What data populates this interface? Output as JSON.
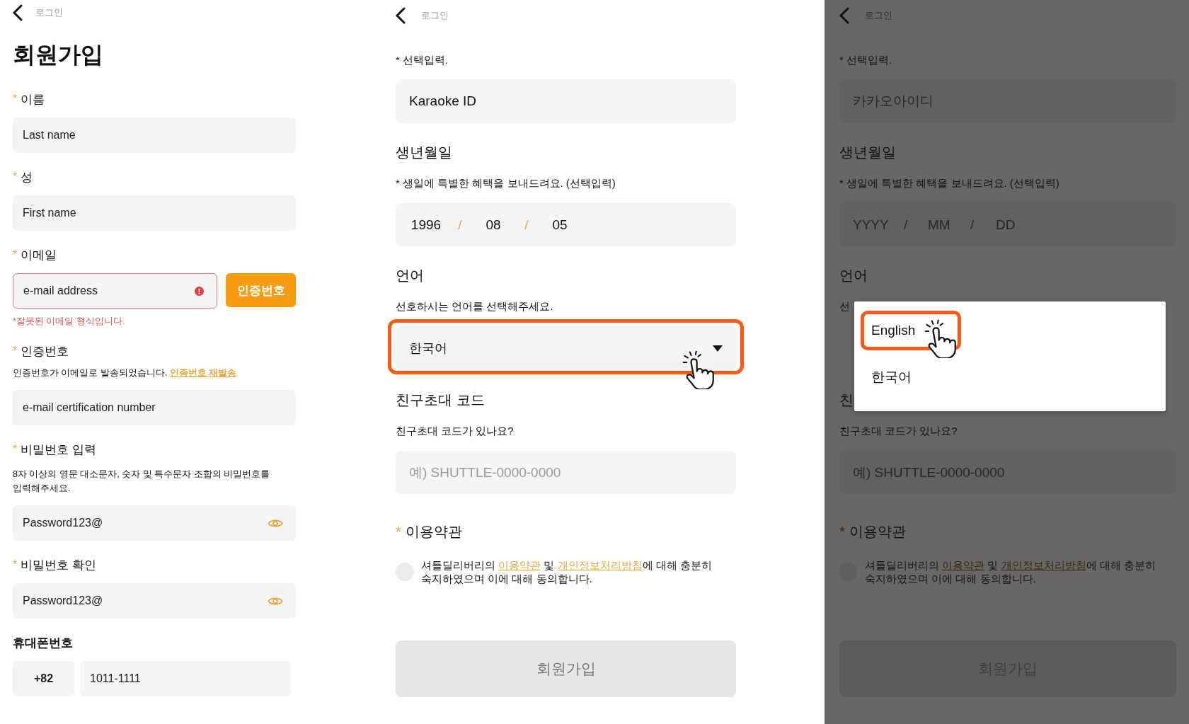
{
  "signup": {
    "back_label": "로그인",
    "title": "회원가입",
    "sections": [
      {
        "kind": "text",
        "mark": "*",
        "label": "이름",
        "value": "Last name"
      },
      {
        "kind": "text",
        "mark": "*",
        "label": "성",
        "value": "First name"
      },
      {
        "kind": "email",
        "mark": "*",
        "label": "이메일",
        "value": "e-mail address",
        "invalid": true,
        "button": "인증번호",
        "error": "*잘못된 이메일 형식입니다."
      },
      {
        "kind": "code",
        "mark": "*",
        "label": "인증번호",
        "helper": "인증번호가 이메일로 발송되었습니다.",
        "link": "인증번호 재발송",
        "value": "e-mail certification number"
      },
      {
        "kind": "password",
        "mark": "*",
        "label": "비밀번호 입력",
        "helper": "8자 이상의 영문 대소문자, 숫자 및 특수문자 조합의 비밀번호를\n입력해주세요.",
        "value": "Password123@"
      },
      {
        "kind": "password",
        "mark": "*",
        "label": "비밀번호 확인",
        "value": "Password123@"
      },
      {
        "kind": "phone",
        "label": "휴대폰번호",
        "country_code": "+82",
        "value": "1011-1111"
      }
    ]
  },
  "detail_screens": [
    {
      "dimmed": false,
      "back_label": "로그인",
      "optional_note": "* 선택입력.",
      "id_field": {
        "value": "Karaoke ID"
      },
      "birthday": {
        "heading": "생년월일",
        "note": "* 생일에 특별한 혜택을 보내드려요. (선택입력)",
        "parts": [
          {
            "value": "1996"
          },
          {
            "value": "08"
          },
          {
            "value": "05"
          }
        ],
        "separators": [
          "/",
          "/"
        ]
      },
      "language": {
        "heading": "언어",
        "note": "선호하시는 언어를 선택해주세요.",
        "dropdown": {
          "value": "한국어",
          "highlighted": true
        }
      },
      "referral": {
        "heading": "친구초대 코드",
        "note": "친구초대 코드가 있나요?",
        "placeholder": "예) SHUTTLE-0000-0000"
      },
      "terms": {
        "mark": "*",
        "heading": "이용약관",
        "checked": false,
        "parts": [
          {
            "kind": "text",
            "text": "셔틀딜리버리의 "
          },
          {
            "kind": "link",
            "text": "이용약관"
          },
          {
            "kind": "text",
            "text": " 및 "
          },
          {
            "kind": "link",
            "text": "개인정보처리방침"
          },
          {
            "kind": "text",
            "text": "에 대해 충분히\n숙지하였으며 이에 대해 동의합니다."
          }
        ]
      },
      "submit": {
        "label": "회원가입",
        "disabled": true
      }
    },
    {
      "dimmed": true,
      "back_label": "로그인",
      "optional_note": "* 선택입력.",
      "id_field": {
        "placeholder": "카카오아이디"
      },
      "birthday": {
        "heading": "생년월일",
        "note": "* 생일에 특별한 혜택을 보내드려요. (선택입력)",
        "parts": [
          {
            "placeholder": "YYYY"
          },
          {
            "placeholder": "MM"
          },
          {
            "placeholder": "DD"
          }
        ],
        "separators": [
          "/",
          "/"
        ]
      },
      "language": {
        "heading": "언어",
        "note": "선",
        "menu": {
          "options": [
            {
              "label": "English",
              "highlighted": true
            },
            {
              "label": "한국어",
              "highlighted": false
            }
          ]
        }
      },
      "referral": {
        "heading": "친",
        "note": "친구초대 코드가 있나요?",
        "placeholder": "예) SHUTTLE-0000-0000"
      },
      "terms": {
        "mark": "*",
        "heading": "이용약관",
        "checked": false,
        "parts": [
          {
            "kind": "text",
            "text": "셔틀딜리버리의 "
          },
          {
            "kind": "link",
            "text": "이용약관"
          },
          {
            "kind": "text",
            "text": " 및 "
          },
          {
            "kind": "link",
            "text": "개인정보처리방침"
          },
          {
            "kind": "text",
            "text": "에 대해 충분히\n숙지하였으며 이에 대해 동의합니다."
          }
        ]
      },
      "submit": {
        "label": "회원가입",
        "disabled": true
      }
    }
  ]
}
